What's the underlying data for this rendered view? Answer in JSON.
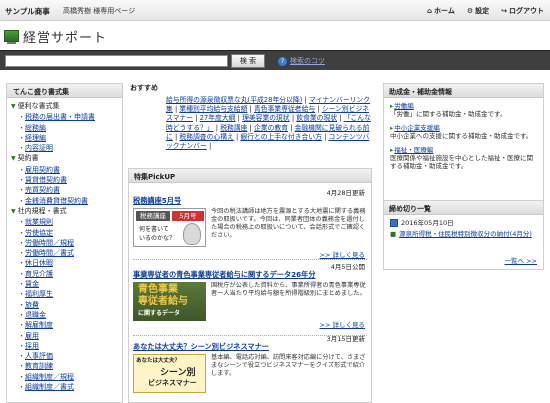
{
  "topbar": {
    "brand": "サンプル商事",
    "sub": "高橋秀樹 様専用ページ",
    "nav": [
      {
        "icon": "home-icon",
        "label": "ホーム"
      },
      {
        "icon": "gear-icon",
        "label": "設定"
      },
      {
        "icon": "logout-icon",
        "label": "ログアウト"
      }
    ]
  },
  "logo": {
    "text": "経営サポート"
  },
  "search": {
    "value": "",
    "button": "検 索",
    "help": "検索のコツ"
  },
  "left": {
    "title": "てんこ盛り書式集",
    "items": [
      {
        "t": "cat",
        "label": "便利な書式集"
      },
      {
        "t": "sub",
        "label": "税務の届出書・申請書"
      },
      {
        "t": "sub",
        "label": "総務編"
      },
      {
        "t": "sub",
        "label": "経理編"
      },
      {
        "t": "sub",
        "label": "内容証明"
      },
      {
        "t": "cat",
        "label": "契約書"
      },
      {
        "t": "sub",
        "label": "雇用契約書"
      },
      {
        "t": "sub",
        "label": "賃貸借契約書"
      },
      {
        "t": "sub",
        "label": "売買契約書"
      },
      {
        "t": "sub",
        "label": "金銭消費貸借契約書"
      },
      {
        "t": "cat",
        "label": "社内規程・書式"
      },
      {
        "t": "sub",
        "label": "就業規則"
      },
      {
        "t": "sub",
        "label": "労使協定"
      },
      {
        "t": "sub",
        "label": "労働時間／規程"
      },
      {
        "t": "sub",
        "label": "労働時間／書式"
      },
      {
        "t": "sub",
        "label": "休日休暇"
      },
      {
        "t": "sub",
        "label": "育児介護"
      },
      {
        "t": "sub",
        "label": "賃金"
      },
      {
        "t": "sub",
        "label": "福利厚生"
      },
      {
        "t": "sub",
        "label": "旅費"
      },
      {
        "t": "sub",
        "label": "退職金"
      },
      {
        "t": "sub",
        "label": "解雇制度"
      },
      {
        "t": "sub",
        "label": "雇用"
      },
      {
        "t": "sub",
        "label": "採用"
      },
      {
        "t": "sub",
        "label": "人事評価"
      },
      {
        "t": "sub",
        "label": "教育訓練"
      },
      {
        "t": "sub",
        "label": "組織制度／規程"
      },
      {
        "t": "sub",
        "label": "組織制度／書式"
      }
    ]
  },
  "osusume": {
    "title": "おすすめ",
    "links": [
      "給与所得の源泉徴収票な丸(平成28年分以降)",
      "マイナンバーリンク集",
      "業種別平均給与支給額",
      "青色事業専従者給与",
      "シーン別ビジネスマナー",
      "27年度大綱",
      "理美容業の現状",
      "飲食業の現状",
      "「こんな時どうする？」",
      "税務講座",
      "企業の教育",
      "金融機関に見破られる前に",
      "税務調査の心構え",
      "銀行との上手な付き合い方",
      "コンテンツバックナンバー"
    ]
  },
  "pickup": {
    "title": "特集PickUP",
    "articles": [
      {
        "date": "4月28日更新",
        "title": "税務講座5月号",
        "img_lines": [
          "税務講座",
          "5月号",
          "何を書いて",
          "いるのかな？"
        ],
        "text": "今回の税法講師は地方を震源とする大地震に関する義務金の取扱いです。今回は、同業者団体の義務金を遺付した場合の税務上の取扱いについて、会話形式でご確認ください。",
        "more": "詳しく見る"
      },
      {
        "date": "4月5日公開",
        "title": "事業専従者の青色事業専従者給与に関するデータ26年分",
        "img_lines": [
          "青色事業",
          "専従者給与",
          "に関するデータ"
        ],
        "text": "国税庁が公表した資料から、事業所得者の青色事業専従者一人当たり平均給与額を所得階級別にまとめました。",
        "more": "詳しく見る"
      },
      {
        "date": "3月15日更新",
        "title": "あなたは大丈夫？シーン別ビジネスマナー",
        "img_lines": [
          "あなたは大丈夫？",
          "シーン別",
          "ビジネスマナー"
        ],
        "text": "基本編、電話応対編、訪問来客対応編に分けて、さまざまなシーンで役立つビジネスマナーをクイズ形式で紹介します。",
        "more": "詳しく見る"
      }
    ]
  },
  "grants": {
    "title": "助成金・補助金情報",
    "items": [
      {
        "label": "労働編",
        "desc": "「労働」に関する補助金・助成金です。"
      },
      {
        "label": "中小企業支援編",
        "desc": "中小企業への支援に関する補助金・助成金です。"
      },
      {
        "label": "福祉・医療編",
        "desc": "医療関係や福祉施設を中心とした福祉・医療に関する補助金・助成金です。"
      }
    ]
  },
  "deadline": {
    "title": "締め切り一覧",
    "items": [
      {
        "date": "2016年05月10日",
        "text": "源泉所得税・住民税特別徴収分の納付(4月分)"
      }
    ],
    "more": "一覧へ >>"
  },
  "colors": {
    "brand_green": "#2a6d22",
    "link": "#0b3b9e",
    "searchbar": "#3f3f3f"
  }
}
